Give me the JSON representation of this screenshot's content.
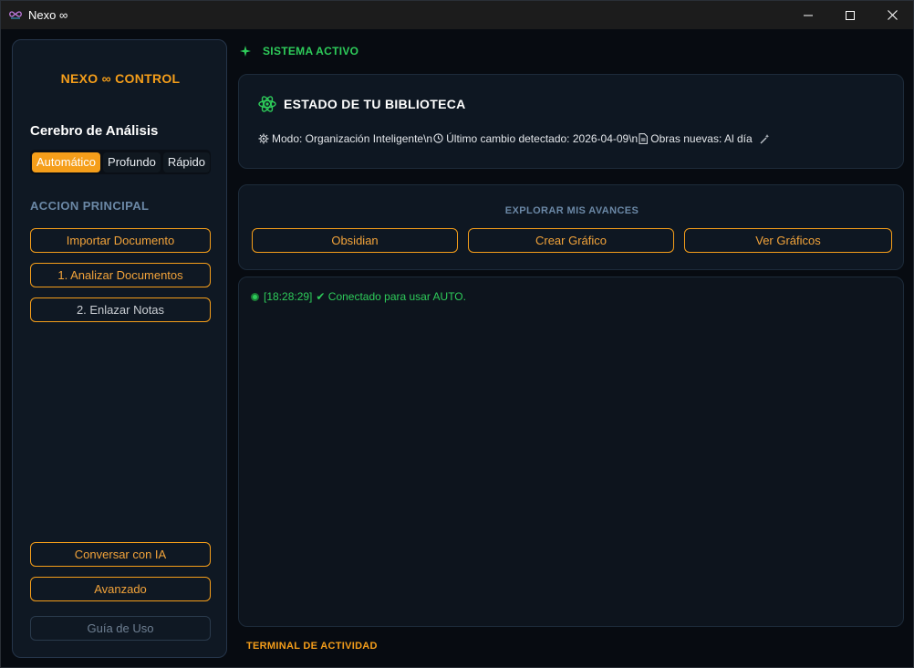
{
  "window": {
    "title": "Nexo ∞"
  },
  "sidebar": {
    "brand": "NEXO ∞ CONTROL",
    "analysis_title": "Cerebro de Análisis",
    "modes": [
      "Automático",
      "Profundo",
      "Rápido"
    ],
    "active_mode": "Automático",
    "main_action_label": "ACCION PRINCIPAL",
    "buttons": {
      "import": "Importar Documento",
      "analyze": "1. Analizar Documentos",
      "link": "2. Enlazar Notas",
      "chat": "Conversar con IA",
      "advanced": "Avanzado",
      "guide": "Guía de Uso"
    }
  },
  "status": {
    "text": "SISTEMA ACTIVO"
  },
  "library": {
    "title": "ESTADO DE TU BIBLIOTECA",
    "mode": "Modo: Organización Inteligente\\n",
    "last_change": "Último cambio detectado: 2026-04-09\\n",
    "new_works": "Obras nuevas: Al día"
  },
  "explore": {
    "title": "EXPLORAR MIS AVANCES",
    "buttons": [
      "Obsidian",
      "Crear Gráfico",
      "Ver Gráficos"
    ]
  },
  "terminal": {
    "label": "TERMINAL DE ACTIVIDAD",
    "lines": [
      {
        "time": "[18:28:29]",
        "text": "✔ Conectado para usar AUTO."
      }
    ]
  },
  "colors": {
    "accent": "#f59e1a",
    "success": "#2ecc5a",
    "panel": "#0f1823",
    "muted_label": "#6b88a6"
  }
}
